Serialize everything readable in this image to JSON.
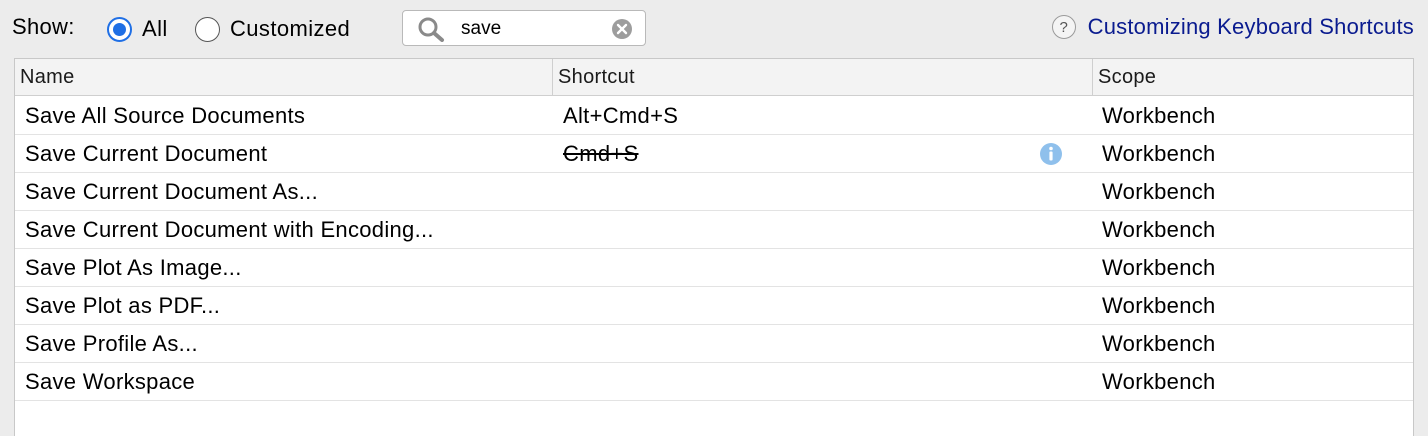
{
  "filter": {
    "show_label": "Show:",
    "options": [
      {
        "label": "All",
        "selected": true
      },
      {
        "label": "Customized",
        "selected": false
      }
    ]
  },
  "search": {
    "value": "save",
    "icon": "search-icon",
    "clear_icon": "clear-icon"
  },
  "help": {
    "icon": "help-icon",
    "icon_glyph": "?",
    "link_text": "Customizing Keyboard Shortcuts"
  },
  "table": {
    "columns": [
      "Name",
      "Shortcut",
      "Scope"
    ],
    "rows": [
      {
        "name": "Save All Source Documents",
        "shortcut": "Alt+Cmd+S",
        "scope": "Workbench",
        "conflict": false
      },
      {
        "name": "Save Current Document",
        "shortcut": "Cmd+S",
        "scope": "Workbench",
        "conflict": true
      },
      {
        "name": "Save Current Document As...",
        "shortcut": "",
        "scope": "Workbench",
        "conflict": false
      },
      {
        "name": "Save Current Document with Encoding...",
        "shortcut": "",
        "scope": "Workbench",
        "conflict": false
      },
      {
        "name": "Save Plot As Image...",
        "shortcut": "",
        "scope": "Workbench",
        "conflict": false
      },
      {
        "name": "Save Plot as PDF...",
        "shortcut": "",
        "scope": "Workbench",
        "conflict": false
      },
      {
        "name": "Save Profile As...",
        "shortcut": "",
        "scope": "Workbench",
        "conflict": false
      },
      {
        "name": "Save Workspace",
        "shortcut": "",
        "scope": "Workbench",
        "conflict": false
      }
    ]
  },
  "colors": {
    "accent": "#1f6fe5",
    "link": "#0a1b8f",
    "info": "#8fc0ec"
  }
}
